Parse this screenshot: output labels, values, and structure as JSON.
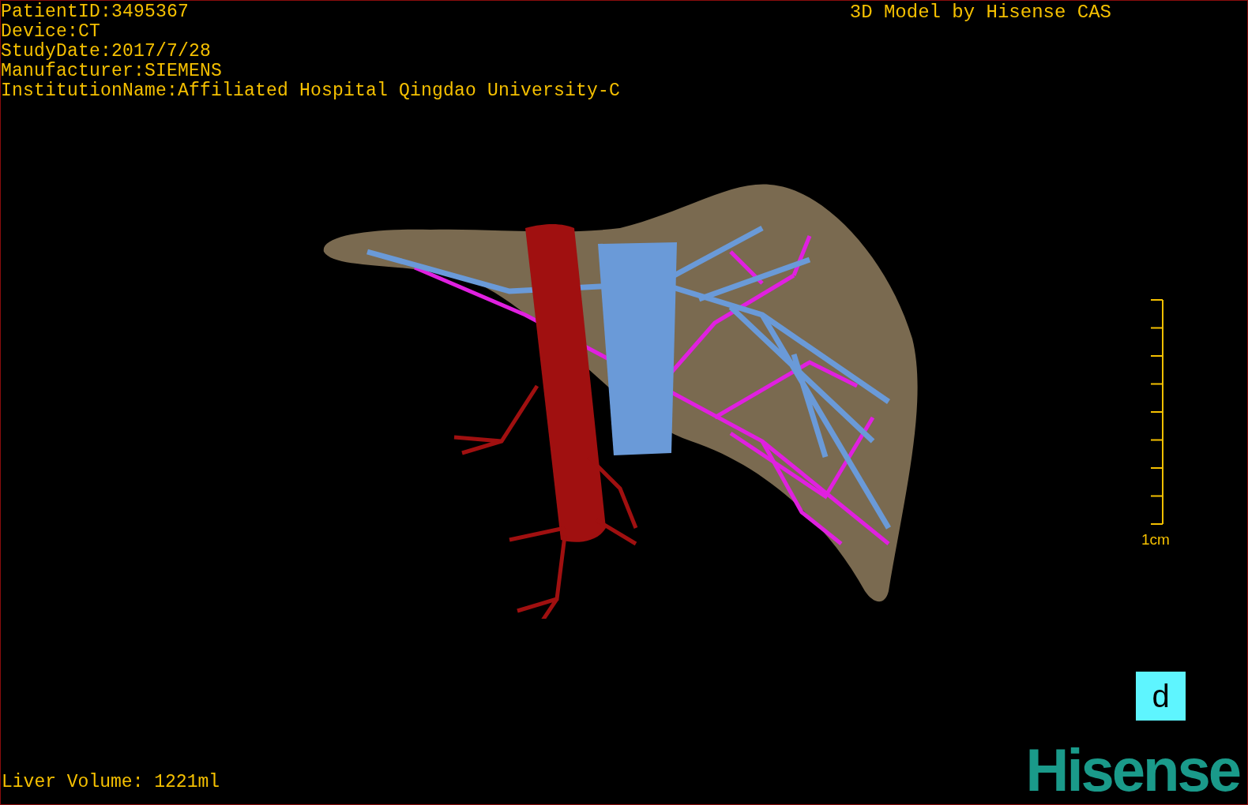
{
  "info_lines": [
    "PatientID:3495367",
    "Device:CT",
    "StudyDate:2017/7/28",
    "Manufacturer:SIEMENS",
    "InstitutionName:Affiliated Hospital Qingdao University-C"
  ],
  "title": "3D Model by Hisense CAS",
  "scale": {
    "label": "1cm"
  },
  "liver_volume": "Liver Volume: 1221ml",
  "panel_label": "d",
  "logo": "Hisense"
}
